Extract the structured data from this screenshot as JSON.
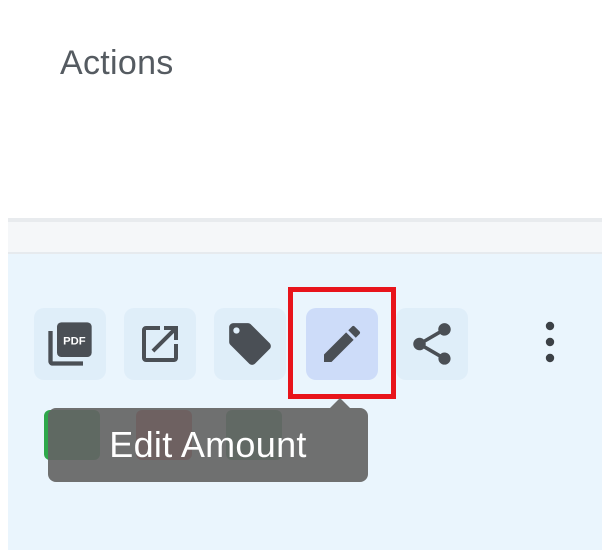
{
  "header": {
    "title": "Actions"
  },
  "actions": [
    {
      "name": "pdf",
      "icon": "pdf-icon",
      "icon_text": "PDF",
      "active": false
    },
    {
      "name": "open-external",
      "icon": "open-external-icon",
      "active": false
    },
    {
      "name": "tag",
      "icon": "tag-icon",
      "active": false
    },
    {
      "name": "edit-amount",
      "icon": "pencil-icon",
      "active": true
    },
    {
      "name": "share",
      "icon": "share-icon",
      "active": false
    },
    {
      "name": "more",
      "icon": "more-vertical-icon",
      "active": false
    }
  ],
  "tooltip": {
    "text": "Edit Amount"
  },
  "colors": {
    "icon": "#4a4f55",
    "row_background": "#eaf5fd",
    "highlight": "#e8141b",
    "tooltip_background": "#646464"
  }
}
